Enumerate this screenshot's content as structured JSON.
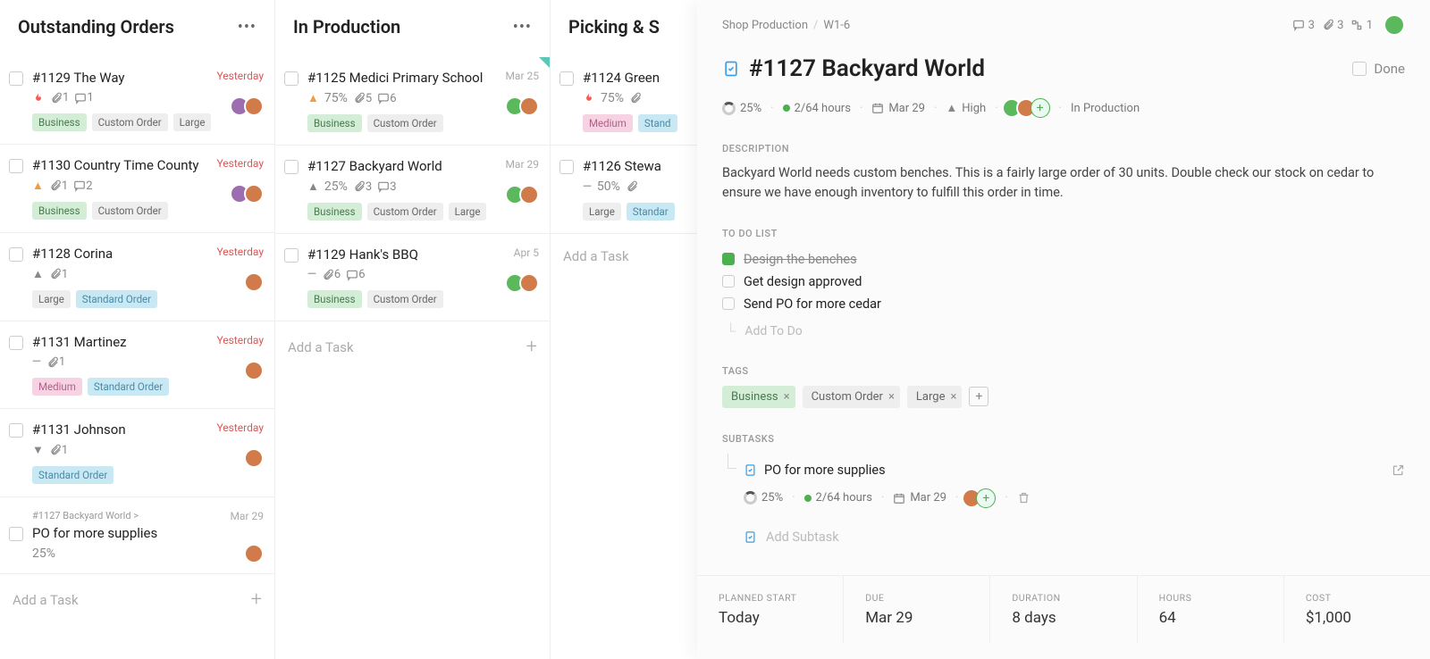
{
  "columns": [
    {
      "title": "Outstanding Orders",
      "add_label": "Add a Task",
      "cards": [
        {
          "name": "#1129 The Way",
          "date": "Yesterday",
          "date_red": true,
          "priority": "urgent",
          "attach": "1",
          "comments": "1",
          "tags": [
            "Business",
            "Custom Order",
            "Large"
          ],
          "avatars": 2
        },
        {
          "name": "#1130 Country Time County",
          "date": "Yesterday",
          "date_red": true,
          "priority": "high-o",
          "attach": "1",
          "comments": "2",
          "tags": [
            "Business",
            "Custom Order"
          ],
          "avatars": 2
        },
        {
          "name": "#1128 Corina",
          "date": "Yesterday",
          "date_red": true,
          "priority": "high-g",
          "attach": "1",
          "tags_alt": [
            "Large",
            "Standard Order"
          ],
          "avatars": 1
        },
        {
          "name": "#1131 Martinez",
          "date": "Yesterday",
          "date_red": true,
          "priority": "none",
          "attach": "1",
          "tags_alt2": [
            "Medium",
            "Standard Order"
          ],
          "avatars": 1
        },
        {
          "name": "#1131 Johnson",
          "date": "Yesterday",
          "date_red": true,
          "priority": "low",
          "attach": "1",
          "tags_std": [
            "Standard Order"
          ],
          "avatars": 1
        },
        {
          "parent": "#1127 Backyard World >",
          "name": "PO for more supplies",
          "date": "Mar 29",
          "pct": "25%",
          "avatars": 1
        }
      ]
    },
    {
      "title": "In Production",
      "add_label": "Add a Task",
      "cards": [
        {
          "name": "#1125 Medici Primary School",
          "date": "Mar 25",
          "priority": "high-o",
          "pct": "75%",
          "attach": "5",
          "comments": "6",
          "tags": [
            "Business",
            "Custom Order"
          ],
          "avatars": 2,
          "corner": true
        },
        {
          "name": "#1127 Backyard World",
          "date": "Mar 29",
          "priority": "high-g",
          "pct": "25%",
          "attach": "3",
          "comments": "3",
          "tags": [
            "Business",
            "Custom Order",
            "Large"
          ],
          "avatars": 2
        },
        {
          "name": "#1129 Hank's BBQ",
          "date": "Apr 5",
          "priority": "none",
          "attach": "6",
          "comments": "6",
          "tags": [
            "Business",
            "Custom Order"
          ],
          "avatars": 2
        }
      ]
    },
    {
      "title": "Picking & S",
      "add_label": "Add a Task",
      "cards": [
        {
          "name": "#1124 Green",
          "priority": "urgent",
          "pct": "75%",
          "tags_alt2": [
            "Medium",
            "Stand"
          ]
        },
        {
          "name": "#1126 Stewa",
          "priority": "none",
          "pct": "50%",
          "tags_alt3": [
            "Large",
            "Standar"
          ]
        }
      ]
    }
  ],
  "panel": {
    "crumb1": "Shop Production",
    "crumb2": "W1-6",
    "comments": "3",
    "attach": "3",
    "subs": "1",
    "title": "#1127 Backyard World",
    "done_label": "Done",
    "pct": "25%",
    "hours": "2/64 hours",
    "due_pill": "Mar 29",
    "priority": "High",
    "status": "In Production",
    "desc_label": "DESCRIPTION",
    "description": "Backyard World needs custom benches. This is a fairly large order of 30 units. Double check our stock on cedar to ensure we have enough inventory to fulfill this order in time.",
    "todo_label": "TO DO LIST",
    "todos": [
      {
        "text": "Design the benches",
        "done": true
      },
      {
        "text": "Get design approved",
        "done": false
      },
      {
        "text": "Send PO for more cedar",
        "done": false
      }
    ],
    "add_todo": "Add To Do",
    "tags_label": "TAGS",
    "tags": [
      "Business",
      "Custom Order",
      "Large"
    ],
    "subtasks_label": "SUBTASKS",
    "subtask": {
      "title": "PO for more supplies",
      "pct": "25%",
      "hours": "2/64 hours",
      "due": "Mar 29"
    },
    "add_subtask": "Add Subtask",
    "footer": {
      "planned_start_label": "PLANNED START",
      "planned_start": "Today",
      "due_label": "DUE",
      "due": "Mar 29",
      "duration_label": "DURATION",
      "duration": "8 days",
      "hours_label": "HOURS",
      "hours": "64",
      "cost_label": "COST",
      "cost": "$1,000"
    }
  }
}
